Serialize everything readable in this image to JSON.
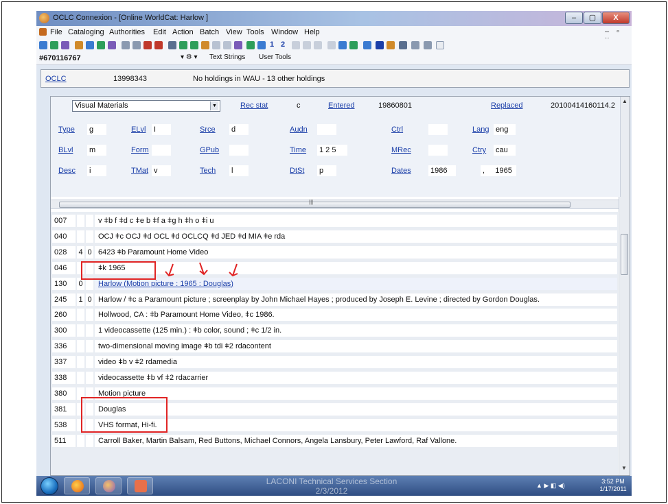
{
  "window": {
    "title": "OCLC Connexion - [Online WorldCat: Harlow ]",
    "controls": {
      "minimize": "–",
      "maximize": "▢",
      "close": "X"
    }
  },
  "menu": {
    "items": [
      "File",
      "Cataloging",
      "Authorities",
      "Edit",
      "Action",
      "Batch",
      "View",
      "Tools",
      "Window",
      "Help"
    ],
    "mdi_controls": "– ▫ ×"
  },
  "toolbar": {
    "numbers": [
      "1",
      "2"
    ],
    "ocn_box": "#670116767",
    "text_strings": "Text Strings",
    "user_tools": "User Tools"
  },
  "record_header": {
    "source_link": "OCLC",
    "oclc_number": "13998343",
    "holdings": "No holdings in WAU - 13 other holdings"
  },
  "fixed_field": {
    "format_select": "Visual Materials",
    "rows": [
      [
        {
          "label": "Rec stat",
          "value": "c"
        },
        {
          "label": "Entered",
          "value": "19860801"
        },
        {
          "label": "Replaced",
          "value": "20100414160114.2"
        }
      ],
      [
        {
          "label": "Type",
          "value": "g"
        },
        {
          "label": "ELvl",
          "value": "I"
        },
        {
          "label": "Srce",
          "value": "d"
        },
        {
          "label": "Audn",
          "value": ""
        },
        {
          "label": "Ctrl",
          "value": ""
        },
        {
          "label": "Lang",
          "value": "eng"
        }
      ],
      [
        {
          "label": "BLvl",
          "value": "m"
        },
        {
          "label": "Form",
          "value": ""
        },
        {
          "label": "GPub",
          "value": ""
        },
        {
          "label": "Time",
          "value": "1 2 5"
        },
        {
          "label": "MRec",
          "value": ""
        },
        {
          "label": "Ctry",
          "value": "cau"
        }
      ],
      [
        {
          "label": "Desc",
          "value": "i"
        },
        {
          "label": "TMat",
          "value": "v"
        },
        {
          "label": "Tech",
          "value": "l"
        },
        {
          "label": "DtSt",
          "value": "p"
        },
        {
          "label": "Dates",
          "value": "1986"
        },
        {
          "label": "",
          "value": ",     1965"
        }
      ]
    ]
  },
  "variable_fields": [
    {
      "tag": "007",
      "ind1": "",
      "ind2": "",
      "content": "v ǂb f ǂd c ǂe b ǂf a ǂg h ǂh o ǂi u",
      "link": false
    },
    {
      "tag": "040",
      "ind1": "",
      "ind2": "",
      "content": "OCJ ǂc OCJ ǂd OCL ǂd OCLCQ ǂd JED ǂd MIA ǂe rda",
      "link": false
    },
    {
      "tag": "028",
      "ind1": "4",
      "ind2": "0",
      "content": "6423 ǂb Paramount Home Video",
      "link": false
    },
    {
      "tag": "046",
      "ind1": "",
      "ind2": "",
      "content": "ǂk 1965",
      "link": false
    },
    {
      "tag": "130",
      "ind1": "0",
      "ind2": "",
      "content": "Harlow (Motion picture : 1965 : Douglas)",
      "link": true
    },
    {
      "tag": "245",
      "ind1": "1",
      "ind2": "0",
      "content": "Harlow / ǂc a Paramount picture ; screenplay by John Michael Hayes ; produced by Joseph E. Levine ; directed by Gordon Douglas.",
      "link": false
    },
    {
      "tag": "260",
      "ind1": "",
      "ind2": "",
      "content": "Hollwood, CA : ǂb Paramount Home Video, ǂc 1986.",
      "link": false
    },
    {
      "tag": "300",
      "ind1": "",
      "ind2": "",
      "content": "1 videocassette (125 min.) : ǂb color, sound ; ǂc 1/2 in.",
      "link": false
    },
    {
      "tag": "336",
      "ind1": "",
      "ind2": "",
      "content": "two-dimensional moving image ǂb tdi ǂ2 rdacontent",
      "link": false
    },
    {
      "tag": "337",
      "ind1": "",
      "ind2": "",
      "content": "video ǂb v ǂ2 rdamedia",
      "link": false
    },
    {
      "tag": "338",
      "ind1": "",
      "ind2": "",
      "content": "videocassette ǂb vf ǂ2 rdacarrier",
      "link": false
    },
    {
      "tag": "380",
      "ind1": "",
      "ind2": "",
      "content": "Motion picture",
      "link": false
    },
    {
      "tag": "381",
      "ind1": "",
      "ind2": "",
      "content": "Douglas",
      "link": false
    },
    {
      "tag": "538",
      "ind1": "",
      "ind2": "",
      "content": "VHS format, Hi-fi.",
      "link": false
    },
    {
      "tag": "511",
      "ind1": "",
      "ind2": "",
      "content": "Carroll Baker, Martin Balsam, Red Buttons, Michael Connors, Angela Lansbury, Peter Lawford, Raf Vallone.",
      "link": false
    }
  ],
  "taskbar": {
    "time": "3:52 PM",
    "date": "1/17/2011"
  },
  "watermark": {
    "line1": "LACONI Technical Services Section",
    "line2": "2/3/2012"
  },
  "colors": {
    "link": "#1a3ea8",
    "annotation": "#e02424",
    "panel": "#eef2f8",
    "taskbar": "#2f4d82"
  }
}
